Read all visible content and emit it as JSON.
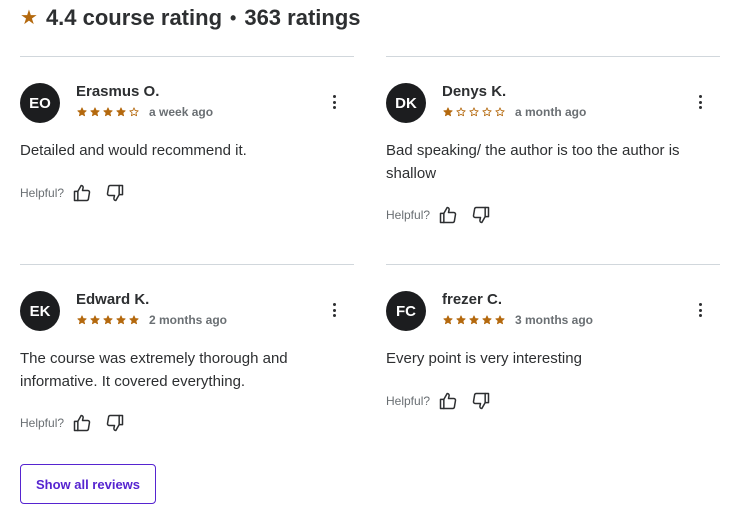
{
  "summary": {
    "rating": "4.4 course rating",
    "separator": "•",
    "count": "363 ratings"
  },
  "helpful_label": "Helpful?",
  "show_all_label": "Show all reviews",
  "colors": {
    "star": "#b4690e",
    "avatar_bg": "#1c1d1f",
    "accent": "#5624d0",
    "divider": "#d1d7dc",
    "muted_text": "#6a6f73"
  },
  "reviews": [
    {
      "initials": "EO",
      "name": "Erasmus O.",
      "stars": 4,
      "date": "a week ago",
      "text": "Detailed and would recommend it."
    },
    {
      "initials": "DK",
      "name": "Denys K.",
      "stars": 1,
      "date": "a month ago",
      "text": "Bad speaking/ the author is too the author is shallow"
    },
    {
      "initials": "EK",
      "name": "Edward K.",
      "stars": 5,
      "date": "2 months ago",
      "text": "The course was extremely thorough and informative. It covered everything."
    },
    {
      "initials": "FC",
      "name": "frezer C.",
      "stars": 5,
      "date": "3 months ago",
      "text": "Every point is very interesting"
    }
  ]
}
